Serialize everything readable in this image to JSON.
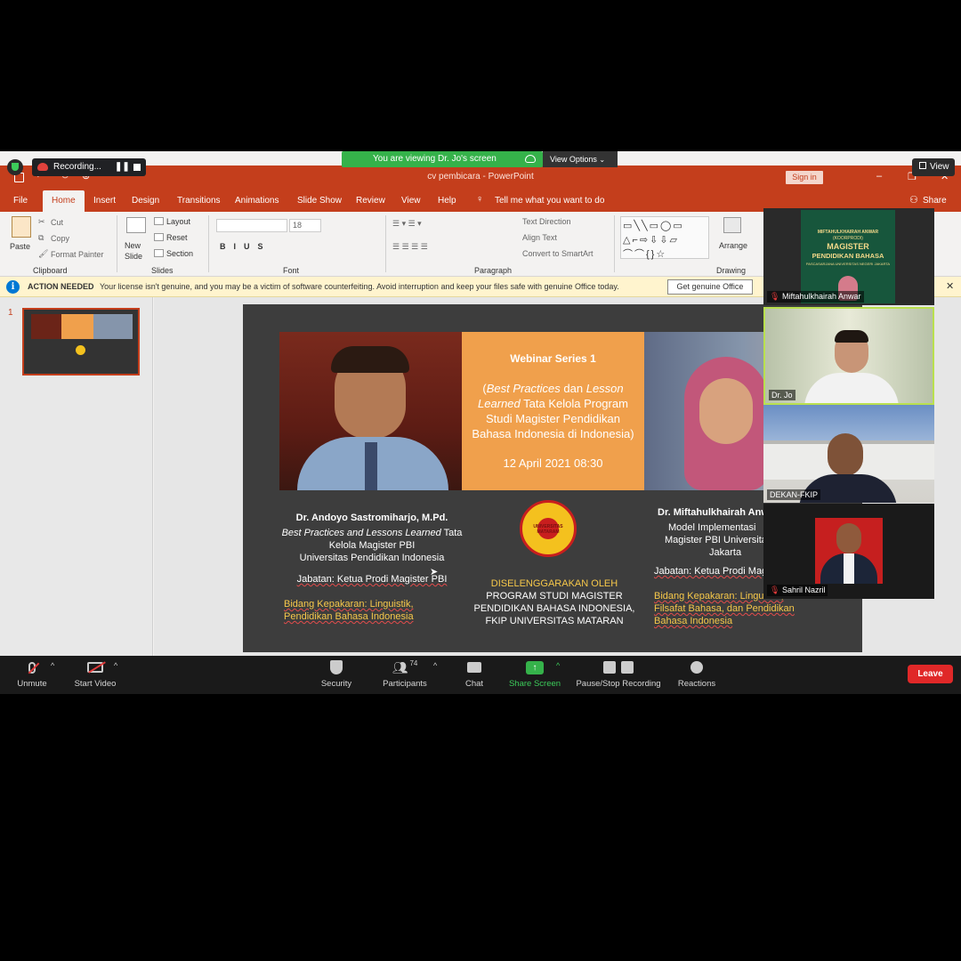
{
  "zoom": {
    "recording_label": "Recording...",
    "viewing_banner": "You are viewing Dr. Jo's screen",
    "view_options": "View Options",
    "view_button": "View",
    "controls": {
      "unmute": "Unmute",
      "start_video": "Start Video",
      "security": "Security",
      "participants": "Participants",
      "participants_count": "74",
      "chat": "Chat",
      "share_screen": "Share Screen",
      "pause_stop_recording": "Pause/Stop Recording",
      "reactions": "Reactions",
      "leave": "Leave"
    },
    "gallery": [
      {
        "name": "Miftahulkhairah Anwar",
        "muted": true
      },
      {
        "name": "Dr. Jo",
        "muted": false
      },
      {
        "name": "DEKAN-FKIP",
        "muted": false
      },
      {
        "name": "Sahril Nazril",
        "muted": true
      }
    ],
    "tile1_banner": {
      "line1": "MIFTAHULKHAIRAH ANWAR",
      "line2": "(KOORPRODI)",
      "line3": "MAGISTER",
      "line4": "PENDIDIKAN BAHASA",
      "line5": "PASCASARJANA UNIVERSITAS NEGERI JAKARTA"
    }
  },
  "powerpoint": {
    "title": "cv pembicara  -  PowerPoint",
    "sign_in": "Sign in",
    "share": "Share",
    "tabs": [
      "File",
      "Home",
      "Insert",
      "Design",
      "Transitions",
      "Animations",
      "Slide Show",
      "Review",
      "View",
      "Help"
    ],
    "tell_me": "Tell me what you want to do",
    "ribbon": {
      "paste": "Paste",
      "cut": "Cut",
      "copy": "Copy",
      "format_painter": "Format Painter",
      "clipboard": "Clipboard",
      "new_slide": "New Slide",
      "layout": "Layout",
      "reset": "Reset",
      "section": "Section",
      "slides": "Slides",
      "font_size": "18",
      "font": "Font",
      "text_direction": "Text Direction",
      "align_text": "Align Text",
      "convert_smartart": "Convert to SmartArt",
      "paragraph": "Paragraph",
      "arrange": "Arrange",
      "drawing": "Drawing"
    },
    "action_needed": {
      "label": "ACTION NEEDED",
      "message": "Your license isn't genuine, and you may be a victim of software counterfeiting. Avoid interruption and keep your files safe with genuine Office today.",
      "button": "Get genuine Office"
    },
    "slide_number": "1"
  },
  "slide": {
    "webinar_title": "Webinar Series 1",
    "topic_italic1": "Best Practices",
    "topic_normal1": " dan ",
    "topic_italic2": "Lesson Learned",
    "topic_rest": " Tata Kelola Program Studi Magister Pendidikan Bahasa Indonesia di Indonesia)",
    "date": "12 April 2021 08:30",
    "speaker1": {
      "name": "Dr. Andoyo Sastromiharjo, M.Pd.",
      "topic_italic": "Best Practices and Lessons Learned",
      "topic_rest": " Tata Kelola Magister PBI",
      "univ": "Universitas Pendidikan Indonesia",
      "jabatan": "Jabatan:  Ketua Prodi Magister PBI",
      "bidang": "Bidang Kepakaran:  Linguistik, Pendidikan Bahasa Indonesia"
    },
    "organizer": {
      "logo_text": "UNIVERSITAS MATARAM",
      "label": "DISELENGGARAKAN OLEH",
      "line1": "PROGRAM STUDI MAGISTER",
      "line2": "PENDIDIKAN BAHASA INDONESIA,",
      "line3": "FKIP UNIVERSITAS MATARAN"
    },
    "speaker2": {
      "name": "Dr. Miftahulkhairah Anwar",
      "line1": "Model Implementasi",
      "line2": "Magister PBI Universitas",
      "line3": "Jakarta",
      "jabatan": "Jabatan:  Ketua Prodi Magister",
      "bidang": "Bidang Kepakaran:  Linguistik, Filsafat Bahasa, dan Pendidikan Bahasa Indonesia"
    }
  }
}
